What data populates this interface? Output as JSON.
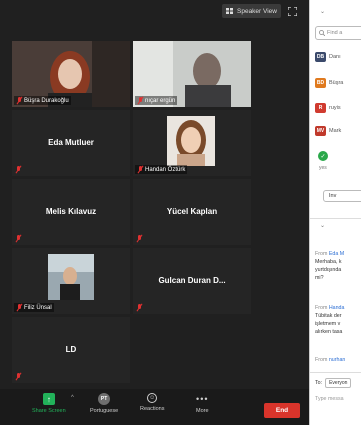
{
  "window": {
    "speaker_view": "Speaker View"
  },
  "tiles": {
    "busra": {
      "label": "Büşra Durakoğlu"
    },
    "nicar": {
      "label": "nıçar ergün"
    },
    "eda": {
      "name": "Eda Mutluer"
    },
    "handan": {
      "label": "Handan Öztürk"
    },
    "melis": {
      "name": "Melis Kılavuz"
    },
    "yucel": {
      "name": "Yücel Kaplan"
    },
    "filiz": {
      "label": "Filiz Ünsal"
    },
    "gulcan": {
      "name": "Gulcan Duran D..."
    },
    "ld": {
      "name": "LD"
    }
  },
  "toolbar": {
    "share_label": "Share Screen",
    "portuguese_label": "Portuguese",
    "portuguese_initials": "PT",
    "reactions_label": "Reactions",
    "more_label": "More",
    "end_label": "End"
  },
  "panel": {
    "search_placeholder": "Find a",
    "participants": [
      {
        "initials": "DB",
        "name": "Danı",
        "color": "#3b4a6b"
      },
      {
        "initials": "BD",
        "name": "Büşra",
        "color": "#e07a1f"
      },
      {
        "initials": "R",
        "name": "ruyis",
        "color": "#d03b2f"
      },
      {
        "initials": "MV",
        "name": "Mark",
        "color": "#c0392b"
      }
    ],
    "yes_label": "yes",
    "invite_label": "Inv",
    "chat": [
      {
        "from": "From",
        "sender": "Eda M",
        "lines": [
          "Merhaba, k",
          "yurtdışında",
          "mi?"
        ]
      },
      {
        "from": "From",
        "sender": "Handa",
        "lines": [
          "Tübitak der",
          "işletmem v",
          "alırken tasa"
        ]
      },
      {
        "from": "From",
        "sender": "nurhan",
        "lines": []
      }
    ],
    "to_label": "To:",
    "to_value": "Everyon",
    "type_placeholder": "Type messa"
  },
  "colors": {
    "share_green": "#22b25a",
    "end_red": "#d9342b"
  }
}
